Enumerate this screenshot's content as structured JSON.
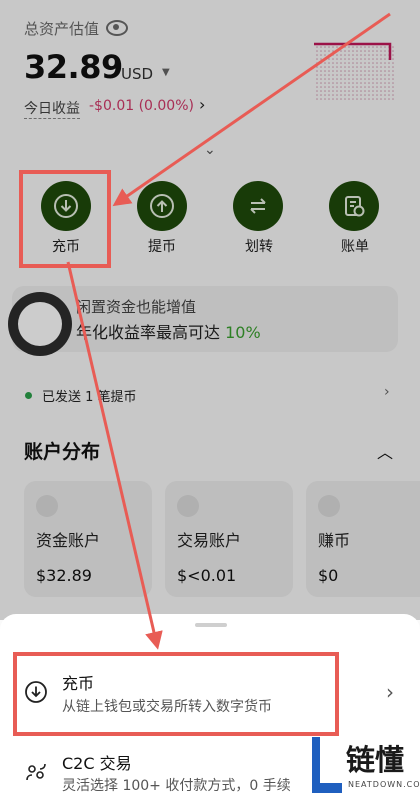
{
  "header": {
    "total_label": "总资产估值",
    "balance": "32.89",
    "currency": "USD",
    "pnl_label": "今日收益",
    "pnl_value": "-$0.01 (0.00%)"
  },
  "actions": [
    {
      "label": "充币",
      "icon": "deposit-icon"
    },
    {
      "label": "提币",
      "icon": "withdraw-icon"
    },
    {
      "label": "划转",
      "icon": "transfer-icon"
    },
    {
      "label": "账单",
      "icon": "bill-icon"
    }
  ],
  "promo": {
    "line1": "闲置资金也能增值",
    "line2_prefix": "年化收益率最高可达",
    "line2_rate": "10%"
  },
  "status": "已发送 1 笔提币",
  "accounts": {
    "title": "账户分布",
    "items": [
      {
        "name": "资金账户",
        "value": "$32.89"
      },
      {
        "name": "交易账户",
        "value": "$<0.01"
      },
      {
        "name": "赚币",
        "value": "$0"
      }
    ]
  },
  "sheet": {
    "items": [
      {
        "title": "充币",
        "subtitle": "从链上钱包或交易所转入数字货币",
        "icon": "deposit-icon"
      },
      {
        "title": "C2C 交易",
        "subtitle": "灵活选择 100+ 收付款方式，0 手续",
        "icon": "c2c-icon"
      }
    ]
  },
  "watermark": {
    "text": "链懂",
    "sub": "NEATDOWN.COM"
  },
  "colors": {
    "accent_green": "#1f4a0b",
    "annotation_red": "#e85c55",
    "loss_pink": "#d33a6b",
    "rate_green": "#3aa02f"
  }
}
